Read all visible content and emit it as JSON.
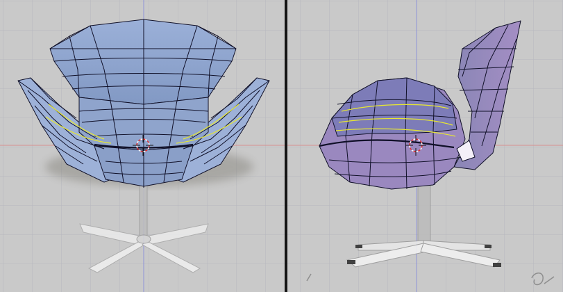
{
  "app": {
    "title": ""
  },
  "viewports": [
    {
      "id": "front",
      "view": "front-ortho",
      "label": ""
    },
    {
      "id": "side",
      "view": "side-ortho",
      "label": ""
    }
  ],
  "colors": {
    "background": "#c9c9c9",
    "grid_line": "#b6b8be",
    "x_axis": "#d89090",
    "z_axis": "#8f92d8",
    "divider": "#151515",
    "mesh_front_fill": "#8fa4cc",
    "mesh_side_fill": "#9c8ac0",
    "wire": "#101028",
    "selected_edge": "#e8e830",
    "cursor_ring": "#e22a2a",
    "base_metal": "#e4e4e4"
  },
  "icons": [
    "3d-cursor-icon",
    "corner-watermark-icon"
  ]
}
